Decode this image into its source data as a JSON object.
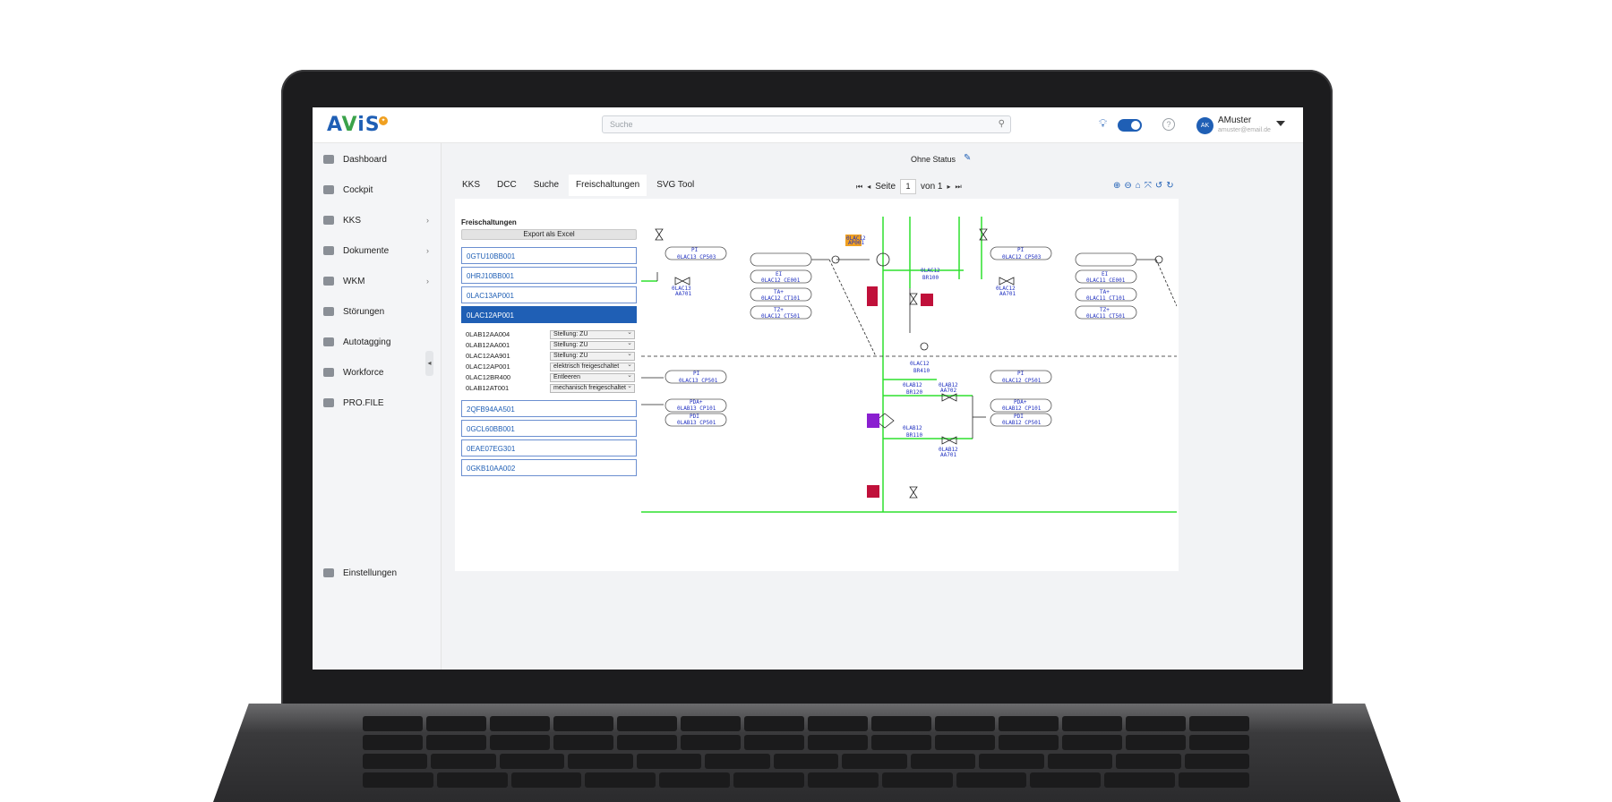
{
  "app": {
    "logo_text_a": "A",
    "logo_text_v": "V",
    "logo_text_is": "iS"
  },
  "header": {
    "search_placeholder": "Suche",
    "user_initials": "AK",
    "user_name": "AMuster",
    "user_email": "amuster@email.de"
  },
  "sidebar": {
    "items": [
      {
        "label": "Dashboard",
        "icon": "pie-chart-icon"
      },
      {
        "label": "Cockpit",
        "icon": "grid-icon"
      },
      {
        "label": "KKS",
        "icon": "hierarchy-icon"
      },
      {
        "label": "Dokumente",
        "icon": "folder-icon"
      },
      {
        "label": "WKM",
        "icon": "calendar-icon"
      },
      {
        "label": "Störungen",
        "icon": "lightning-icon"
      },
      {
        "label": "Autotagging",
        "icon": "tag-icon"
      },
      {
        "label": "Workforce",
        "icon": "briefcase-icon"
      },
      {
        "label": "PRO.FILE",
        "icon": "file-icon"
      }
    ],
    "settings_label": "Einstellungen"
  },
  "main": {
    "status_label": "Ohne Status",
    "tabs": [
      {
        "label": "KKS"
      },
      {
        "label": "DCC"
      },
      {
        "label": "Suche"
      },
      {
        "label": "Freischaltungen"
      },
      {
        "label": "SVG Tool"
      }
    ],
    "pager": {
      "seite_label": "Seite",
      "page": "1",
      "von_label": "von 1"
    }
  },
  "freischaltungen": {
    "title": "Freischaltungen",
    "export_label": "Export als Excel",
    "items_top": [
      "0GTU10BB001",
      "0HRJ10BB001",
      "0LAC13AP001",
      "0LAC12AP001"
    ],
    "selected_index": 3,
    "steps": [
      {
        "code": "0LAB12AA004",
        "value": "Stellung: ZU"
      },
      {
        "code": "0LAB12AA001",
        "value": "Stellung: ZU"
      },
      {
        "code": "0LAC12AA901",
        "value": "Stellung: ZU"
      },
      {
        "code": "0LAC12AP001",
        "value": "elektrisch freigeschaltet"
      },
      {
        "code": "0LAC12BR400",
        "value": "Entleeren"
      },
      {
        "code": "0LAB12AT001",
        "value": "mechanisch freigeschaltet"
      }
    ],
    "items_bottom": [
      "2QFB94AA501",
      "0GCL60BB001",
      "0EAE07EG301",
      "0GKB10AA002"
    ]
  },
  "diagram": {
    "labels": [
      "PI",
      "0LAC13 CP503",
      "0LAC13",
      "AA701",
      "EI",
      "0LAC12 CE001",
      "TA+",
      "0LAC12 CT101",
      "TZ+",
      "0LAC12 CT501",
      "0LAC12",
      "BR100",
      "PI",
      "0LAC12 CP503",
      "0LAC12",
      "AA701",
      "EI",
      "0LAC11 CE001",
      "TA+",
      "0LAC11 CT101",
      "TZ+",
      "0LAC11 CT501",
      "PI",
      "0LAC13 CP501",
      "PDA+",
      "0LAB13 CP101",
      "PDI",
      "0LAB13 CP501",
      "0LAC12",
      "BR410",
      "PI",
      "0LAC12 CP501",
      "0LAB12",
      "BR120",
      "0LAB12",
      "AA702",
      "PDA+",
      "0LAB12 CP101",
      "PDI",
      "0LAB12 CP501",
      "0LAB12",
      "BR110",
      "0LAB12",
      "AA701",
      "0LAC12",
      "AP001"
    ],
    "colors": {
      "pipe": "#2ee02e",
      "line": "#222222",
      "label": "#2030c0",
      "tag_orange": "#f0a020",
      "tag_red": "#c0103a",
      "tag_purple": "#8a1fd0"
    }
  }
}
